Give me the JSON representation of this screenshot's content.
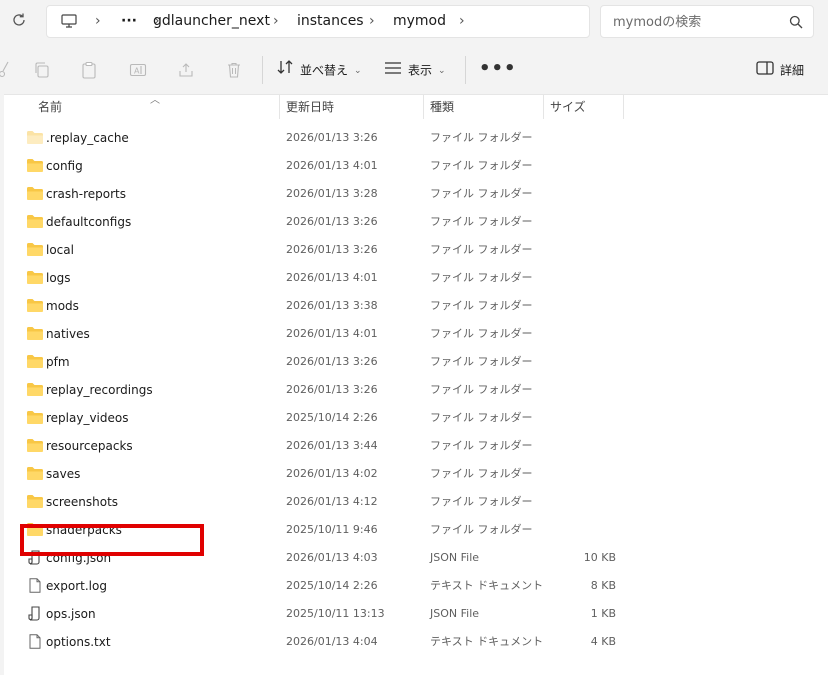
{
  "breadcrumb": {
    "overflow": "···",
    "items": [
      "gdlauncher_next",
      "instances",
      "mymod"
    ],
    "separator": "›"
  },
  "search": {
    "placeholder": "mymodの検索"
  },
  "toolbar": {
    "sort_label": "並べ替え",
    "view_label": "表示",
    "more_label": "•••",
    "details_label": "詳細"
  },
  "columns": {
    "name": "名前",
    "date": "更新日時",
    "type": "種類",
    "size": "サイズ"
  },
  "files": [
    {
      "name": ".replay_cache",
      "date": "2026/01/13 3:26",
      "type": "ファイル フォルダー",
      "size": "",
      "icon": "folder-icon"
    },
    {
      "name": "config",
      "date": "2026/01/13 4:01",
      "type": "ファイル フォルダー",
      "size": "",
      "icon": "folder-icon"
    },
    {
      "name": "crash-reports",
      "date": "2026/01/13 3:28",
      "type": "ファイル フォルダー",
      "size": "",
      "icon": "folder-icon"
    },
    {
      "name": "defaultconfigs",
      "date": "2026/01/13 3:26",
      "type": "ファイル フォルダー",
      "size": "",
      "icon": "folder-icon"
    },
    {
      "name": "local",
      "date": "2026/01/13 3:26",
      "type": "ファイル フォルダー",
      "size": "",
      "icon": "folder-icon"
    },
    {
      "name": "logs",
      "date": "2026/01/13 4:01",
      "type": "ファイル フォルダー",
      "size": "",
      "icon": "folder-icon"
    },
    {
      "name": "mods",
      "date": "2026/01/13 3:38",
      "type": "ファイル フォルダー",
      "size": "",
      "icon": "folder-icon"
    },
    {
      "name": "natives",
      "date": "2026/01/13 4:01",
      "type": "ファイル フォルダー",
      "size": "",
      "icon": "folder-icon"
    },
    {
      "name": "pfm",
      "date": "2026/01/13 3:26",
      "type": "ファイル フォルダー",
      "size": "",
      "icon": "folder-icon"
    },
    {
      "name": "replay_recordings",
      "date": "2026/01/13 3:26",
      "type": "ファイル フォルダー",
      "size": "",
      "icon": "folder-icon"
    },
    {
      "name": "replay_videos",
      "date": "2025/10/14 2:26",
      "type": "ファイル フォルダー",
      "size": "",
      "icon": "folder-icon"
    },
    {
      "name": "resourcepacks",
      "date": "2026/01/13 3:44",
      "type": "ファイル フォルダー",
      "size": "",
      "icon": "folder-icon"
    },
    {
      "name": "saves",
      "date": "2026/01/13 4:02",
      "type": "ファイル フォルダー",
      "size": "",
      "icon": "folder-icon"
    },
    {
      "name": "screenshots",
      "date": "2026/01/13 4:12",
      "type": "ファイル フォルダー",
      "size": "",
      "icon": "folder-icon"
    },
    {
      "name": "shaderpacks",
      "date": "2025/10/11 9:46",
      "type": "ファイル フォルダー",
      "size": "",
      "icon": "folder-icon"
    },
    {
      "name": "config.json",
      "date": "2026/01/13 4:03",
      "type": "JSON File",
      "size": "10 KB",
      "icon": "json-file-icon"
    },
    {
      "name": "export.log",
      "date": "2025/10/14 2:26",
      "type": "テキスト ドキュメント",
      "size": "8 KB",
      "icon": "text-file-icon"
    },
    {
      "name": "ops.json",
      "date": "2025/10/11 13:13",
      "type": "JSON File",
      "size": "1 KB",
      "icon": "json-file-icon"
    },
    {
      "name": "options.txt",
      "date": "2026/01/13 4:04",
      "type": "テキスト ドキュメント",
      "size": "4 KB",
      "icon": "text-file-icon"
    }
  ],
  "highlighted_item": "resourcepacks",
  "colors": {
    "folder": "#f8c746",
    "highlight": "#e00000"
  }
}
